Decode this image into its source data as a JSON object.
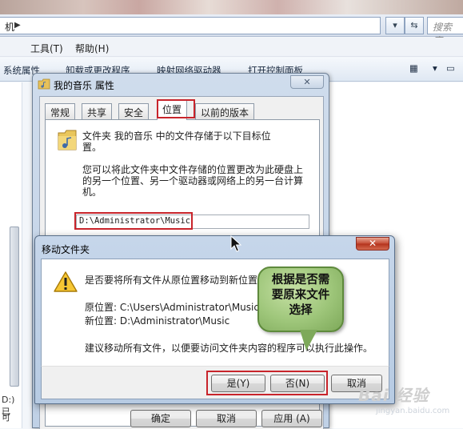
{
  "explorer": {
    "address_text": "机",
    "search_placeholder": "搜索 库",
    "menu": [
      "工具(T)",
      "帮助(H)"
    ],
    "commands": [
      "系统属性",
      "卸载或更改程序",
      "映射网络驱动器",
      "打开控制面板"
    ],
    "status_left_1": "D:)  已",
    "status_left_2": "可"
  },
  "props_dialog": {
    "title": "我的音乐 属性",
    "close_label": "✕",
    "tabs": [
      "常规",
      "共享",
      "安全",
      "位置",
      "以前的版本"
    ],
    "active_tab": "位置",
    "desc1_line1": "文件夹 我的音乐 中的文件存储于以下目标位",
    "desc1_line2": "置。",
    "desc2_line1": "您可以将此文件夹中文件存储的位置更改为此硬盘上",
    "desc2_line2": "的另一个位置、另一个驱动器或网络上的另一台计算",
    "desc2_line3": "机。",
    "path_value": "D:\\Administrator\\Music",
    "ok_label": "确定",
    "cancel_label": "取消",
    "apply_label": "应用 (A)"
  },
  "move_dialog": {
    "title": "移动文件夹",
    "close_label": "✕",
    "question": "是否要将所有文件从原位置移动到新位置?",
    "origin_line": "原位置: C:\\Users\\Administrator\\Music",
    "new_line": "新位置: D:\\Administrator\\Music",
    "advice": "建议移动所有文件，以便要访问文件夹内容的程序可以执行此操作。",
    "yes_label": "是(Y)",
    "no_label": "否(N)",
    "cancel_label": "取消"
  },
  "callout": {
    "line1": "根据是否需",
    "line2": "要原来文件",
    "line3": "选择"
  },
  "watermark": {
    "brand": "Bai 经验",
    "url": "jingyan.baidu.com"
  },
  "colors": {
    "highlight_red": "#c8242b",
    "callout_green": "#9ec67a",
    "title_blue": "#c6d6ea"
  }
}
